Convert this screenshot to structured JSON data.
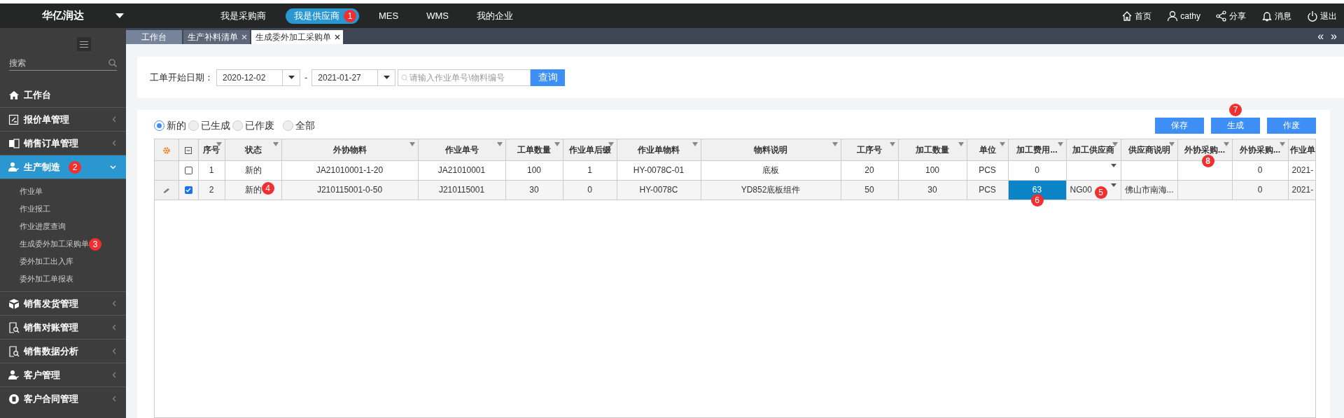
{
  "topbar": {
    "brand": "华亿润达",
    "nav": [
      {
        "label": "我是采购商",
        "selected": false
      },
      {
        "label": "我是供应商",
        "selected": true,
        "badge": "1"
      },
      {
        "label": "MES",
        "selected": false
      },
      {
        "label": "WMS",
        "selected": false
      },
      {
        "label": "我的企业",
        "selected": false
      }
    ],
    "actions": [
      "首页",
      "cathy",
      "分享",
      "消息",
      "退出"
    ]
  },
  "tabs": [
    {
      "label": "工作台",
      "selected": false,
      "closable": false
    },
    {
      "label": "生产补料清单",
      "selected": false,
      "closable": true
    },
    {
      "label": "生成委外加工采购单",
      "selected": true,
      "closable": true
    }
  ],
  "tab_scroll": [
    "«",
    "»"
  ],
  "sidebar": {
    "search_placeholder": "搜索",
    "items": [
      {
        "label": "工作台",
        "kind": "link",
        "selected": false
      },
      {
        "label": "报价单管理",
        "kind": "menu",
        "selected": false,
        "expanded": false
      },
      {
        "label": "销售订单管理",
        "kind": "menu",
        "selected": false,
        "expanded": false
      },
      {
        "label": "生产制造",
        "kind": "menu",
        "selected": true,
        "expanded": true,
        "badge": "2",
        "children": [
          {
            "label": "作业单"
          },
          {
            "label": "作业报工"
          },
          {
            "label": "作业进度查询"
          },
          {
            "label": "生成委外加工采购单",
            "badge": "3"
          },
          {
            "label": "委外加工出入库"
          },
          {
            "label": "委外加工单报表"
          }
        ]
      },
      {
        "label": "销售发货管理",
        "kind": "menu",
        "selected": false,
        "expanded": false
      },
      {
        "label": "销售对账管理",
        "kind": "menu",
        "selected": false,
        "expanded": false
      },
      {
        "label": "销售数据分析",
        "kind": "menu",
        "selected": false,
        "expanded": false
      },
      {
        "label": "客户管理",
        "kind": "menu",
        "selected": false,
        "expanded": false
      },
      {
        "label": "客户合同管理",
        "kind": "menu",
        "selected": false,
        "expanded": false
      }
    ]
  },
  "filter": {
    "label": "工单开始日期：",
    "date_from": "2020-12-02",
    "separator": "-",
    "date_to": "2021-01-27",
    "search": {
      "placeholder": "请输入作业单号\\物料编号"
    },
    "query_button": "查询"
  },
  "status_filter": [
    {
      "label": "新的",
      "selected": true
    },
    {
      "label": "已生成",
      "selected": false
    },
    {
      "label": "已作废",
      "selected": false
    },
    {
      "label": "全部",
      "selected": false
    }
  ],
  "buttons": [
    {
      "label": "保存"
    },
    {
      "label": "生成",
      "badge": "7"
    },
    {
      "label": "作废"
    }
  ],
  "table": {
    "columns": [
      {
        "label": "序号",
        "kind": "text"
      },
      {
        "label": "状态",
        "kind": "text"
      },
      {
        "label": "外协物料",
        "kind": "text"
      },
      {
        "label": "作业单号",
        "kind": "text"
      },
      {
        "label": "工单数量",
        "kind": "text"
      },
      {
        "label": "作业单后缀",
        "kind": "text"
      },
      {
        "label": "作业单物料",
        "kind": "text"
      },
      {
        "label": "物料说明",
        "kind": "text"
      },
      {
        "label": "工序号",
        "kind": "text"
      },
      {
        "label": "加工数量",
        "kind": "text"
      },
      {
        "label": "单位",
        "kind": "text"
      },
      {
        "label": "加工费用...",
        "kind": "text"
      },
      {
        "label": "加工供应商",
        "kind": "dropdown"
      },
      {
        "label": "供应商说明",
        "kind": "text"
      },
      {
        "label": "外协采购...",
        "kind": "text",
        "badge": "8"
      },
      {
        "label": "外协采购...",
        "kind": "text"
      },
      {
        "label": "作业单",
        "kind": "cut"
      }
    ],
    "rows": [
      {
        "selected": false,
        "editing": false,
        "cells": [
          {
            "text": "1",
            "focused": false
          },
          {
            "text": "新的",
            "focused": false
          },
          {
            "text": "JA21010001-1-20",
            "focused": false
          },
          {
            "text": "JA21010001",
            "focused": false
          },
          {
            "text": "100",
            "focused": false
          },
          {
            "text": "1",
            "focused": false
          },
          {
            "text": "HY-0078C-01",
            "focused": false
          },
          {
            "text": "底板",
            "focused": false
          },
          {
            "text": "20",
            "focused": false
          },
          {
            "text": "100",
            "focused": false
          },
          {
            "text": "PCS",
            "focused": false
          },
          {
            "text": "0",
            "focused": false
          },
          {
            "focused": false
          },
          {
            "focused": false
          },
          {
            "focused": false
          },
          {
            "text": "0",
            "focused": false
          },
          {
            "text": "2021-",
            "focused": false
          }
        ]
      },
      {
        "selected": true,
        "editing": true,
        "cells": [
          {
            "text": "2",
            "focused": false
          },
          {
            "text": "新的",
            "focused": false,
            "badge": "4"
          },
          {
            "text": "J210115001-0-50",
            "focused": false
          },
          {
            "text": "J210115001",
            "focused": false
          },
          {
            "text": "30",
            "focused": false
          },
          {
            "text": "0",
            "focused": false
          },
          {
            "text": "HY-0078C",
            "focused": false
          },
          {
            "text": "YD852底板组件",
            "focused": false
          },
          {
            "text": "50",
            "focused": false
          },
          {
            "text": "30",
            "focused": false
          },
          {
            "text": "PCS",
            "focused": false
          },
          {
            "text": "63",
            "focused": true,
            "badge": "6"
          },
          {
            "text": "NG00",
            "focused": false,
            "badge": "5"
          },
          {
            "text": "佛山市南海...",
            "focused": false
          },
          {
            "focused": false
          },
          {
            "text": "0",
            "focused": false
          },
          {
            "text": "2021-",
            "focused": false
          }
        ]
      }
    ]
  }
}
